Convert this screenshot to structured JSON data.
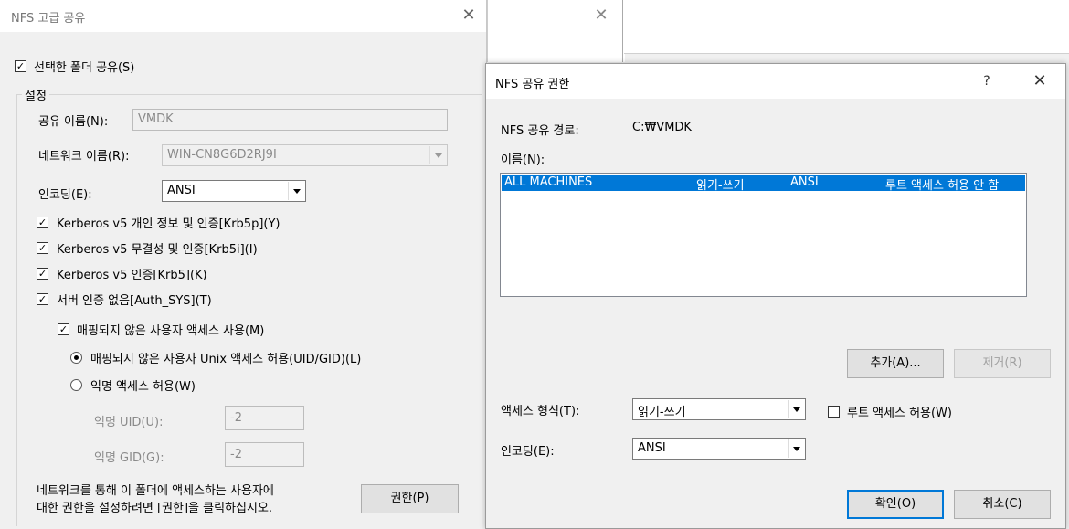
{
  "left_dialog": {
    "title": "NFS 고급 공유",
    "share_folder_label": "선택한 폴더 공유(S)",
    "settings_group": "설정",
    "share_name_label": "공유 이름(N):",
    "share_name_value": "VMDK",
    "network_name_label": "네트워크 이름(R):",
    "network_name_value": "WIN-CN8G6D2RJ9I",
    "encoding_label": "인코딩(E):",
    "encoding_value": "ANSI",
    "auth_options": [
      {
        "label": "Kerberos v5 개인 정보 및 인증[Krb5p](Y)",
        "checked": true
      },
      {
        "label": "Kerberos v5 무결성 및 인증[Krb5i](I)",
        "checked": true
      },
      {
        "label": "Kerberos v5 인증[Krb5](K)",
        "checked": true
      },
      {
        "label": "서버 인증 없음[Auth_SYS](T)",
        "checked": true
      }
    ],
    "unmapped_label": "매핑되지 않은 사용자 액세스 사용(M)",
    "unix_access_label": "매핑되지 않은 사용자 Unix 액세스 허용(UID/GID)(L)",
    "anon_access_label": "익명 액세스 허용(W)",
    "anon_uid_label": "익명 UID(U):",
    "anon_uid_value": "-2",
    "anon_gid_label": "익명 GID(G):",
    "anon_gid_value": "-2",
    "footer_text_1": "네트워크를 통해 이 폴더에 액세스하는 사용자에",
    "footer_text_2": "대한 권한을 설정하려면 [권한]을 클릭하십시오.",
    "permissions_button": "권한(P)"
  },
  "back_window": {
    "close_glyph": "✕"
  },
  "perm_dialog": {
    "title": "NFS 공유 권한",
    "help_glyph": "?",
    "close_glyph": "✕",
    "path_label": "NFS 공유 경로:",
    "path_value": "C:₩VMDK",
    "name_label": "이름(N):",
    "rows": [
      {
        "machine": "ALL MACHINES",
        "access": "읽기-쓰기",
        "encoding": "ANSI",
        "root": "루트 액세스 허용 안 함"
      }
    ],
    "add_button": "추가(A)...",
    "remove_button": "제거(R)",
    "access_type_label": "액세스 형식(T):",
    "access_type_value": "읽기-쓰기",
    "root_access_label": "루트 액세스 허용(W)",
    "encoding_label": "인코딩(E):",
    "encoding_value": "ANSI",
    "ok_button": "확인(O)",
    "cancel_button": "취소(C)"
  },
  "colors": {
    "selection": "#0078d7",
    "window_bg": "#f0f0f0"
  }
}
